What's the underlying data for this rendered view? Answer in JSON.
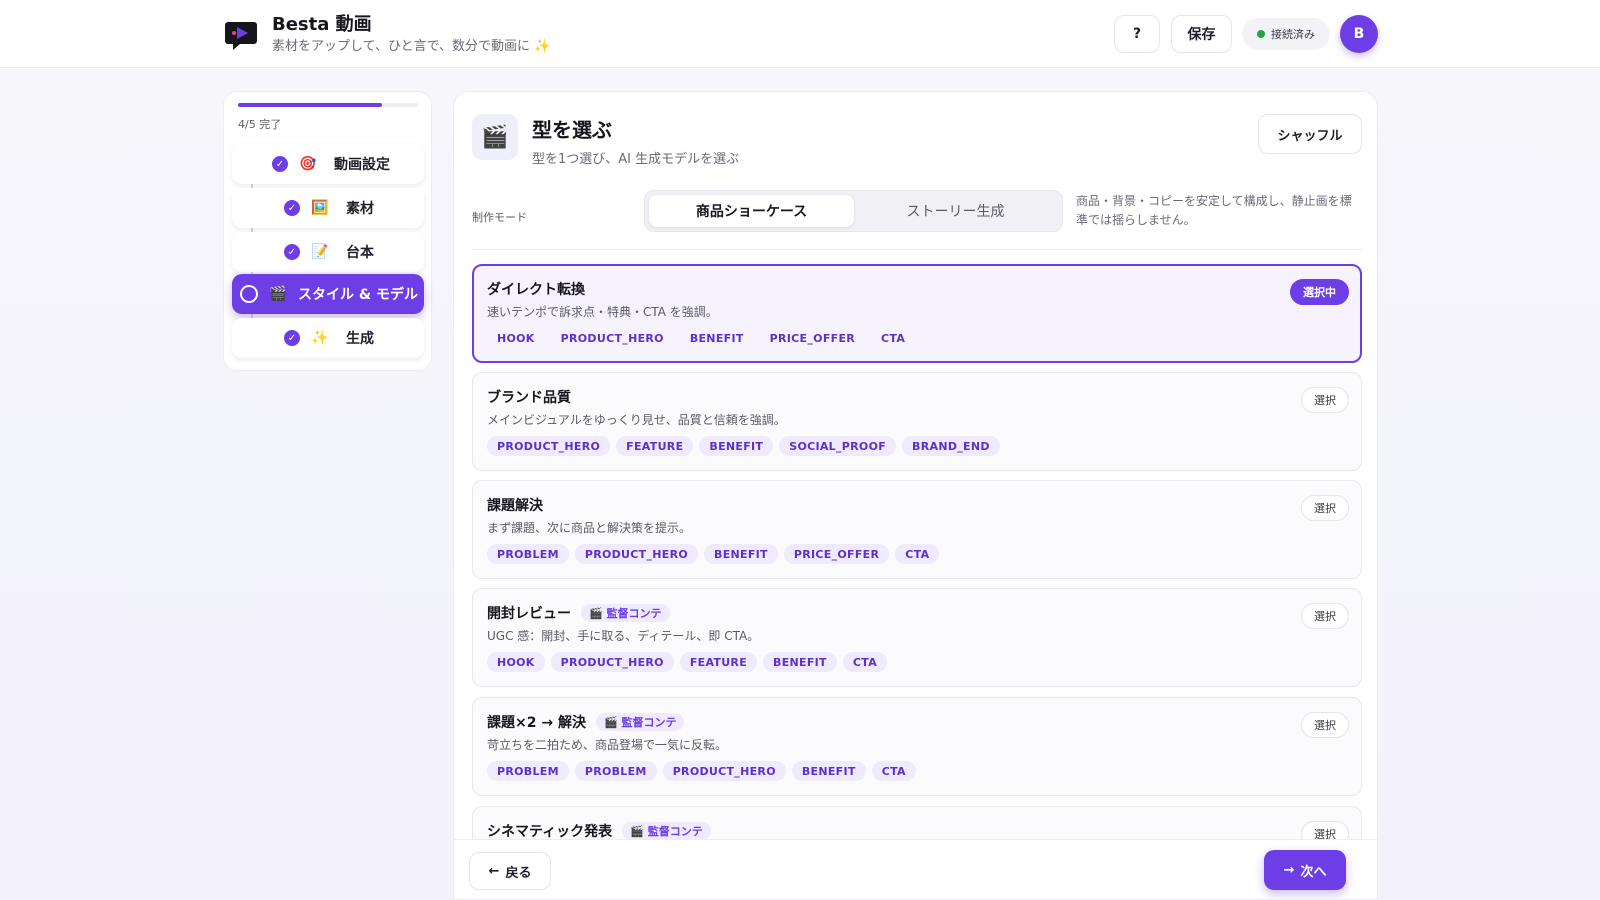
{
  "header": {
    "title": "Besta 動画",
    "subtitle": "素材をアップして、ひと言で、数分で動画に ✨",
    "help_label": "?",
    "save_label": "保存",
    "status_label": "接続済み",
    "status_color": "#22a447",
    "avatar_initial": "B"
  },
  "sidebar": {
    "progress_text": "4/5 完了",
    "progress_value": 0.8,
    "steps": [
      {
        "label": "動画設定",
        "emoji": "🎯",
        "state": "done"
      },
      {
        "label": "素材",
        "emoji": "🖼️",
        "state": "done"
      },
      {
        "label": "台本",
        "emoji": "📝",
        "state": "done"
      },
      {
        "label": "スタイル & モデル",
        "emoji": "🎬",
        "state": "active"
      },
      {
        "label": "生成",
        "emoji": "✨",
        "state": "done"
      }
    ]
  },
  "main": {
    "icon": "🎬",
    "title": "型を選ぶ",
    "subtitle": "型を1つ選び、AI 生成モデルを選ぶ",
    "shuffle_label": "シャッフル",
    "mode_label": "制作モード",
    "modes": [
      "商品ショーケース",
      "ストーリー生成"
    ],
    "mode_description": "商品・背景・コピーを安定して構成し、静止画を標準では揺らしません。",
    "select_label": "選択",
    "selected_label": "選択中",
    "story_badge": "🎬 監督コンテ",
    "templates": [
      {
        "name": "ダイレクト転換",
        "desc": "速いテンポで訴求点・特典・CTA を強調。",
        "tags": [
          "HOOK",
          "PRODUCT_HERO",
          "BENEFIT",
          "PRICE_OFFER",
          "CTA"
        ],
        "selected": true,
        "badge": false
      },
      {
        "name": "ブランド品質",
        "desc": "メインビジュアルをゆっくり見せ、品質と信頼を強調。",
        "tags": [
          "PRODUCT_HERO",
          "FEATURE",
          "BENEFIT",
          "SOCIAL_PROOF",
          "BRAND_END"
        ],
        "selected": false,
        "badge": false
      },
      {
        "name": "課題解決",
        "desc": "まず課題、次に商品と解決策を提示。",
        "tags": [
          "PROBLEM",
          "PRODUCT_HERO",
          "BENEFIT",
          "PRICE_OFFER",
          "CTA"
        ],
        "selected": false,
        "badge": false
      },
      {
        "name": "開封レビュー",
        "desc": "UGC 感：開封、手に取る、ディテール、即 CTA。",
        "tags": [
          "HOOK",
          "PRODUCT_HERO",
          "FEATURE",
          "BENEFIT",
          "CTA"
        ],
        "selected": false,
        "badge": true
      },
      {
        "name": "課題×2 → 解決",
        "desc": "苛立ちを二拍ため、商品登場で一気に反転。",
        "tags": [
          "PROBLEM",
          "PROBLEM",
          "PRODUCT_HERO",
          "BENEFIT",
          "CTA"
        ],
        "selected": false,
        "badge": true
      },
      {
        "name": "シネマティック発表",
        "desc": "",
        "tags": [],
        "selected": false,
        "badge": true
      }
    ]
  },
  "footer": {
    "back_label": "戻る",
    "next_label": "次へ"
  },
  "colors": {
    "accent": "#6d3ee6"
  }
}
